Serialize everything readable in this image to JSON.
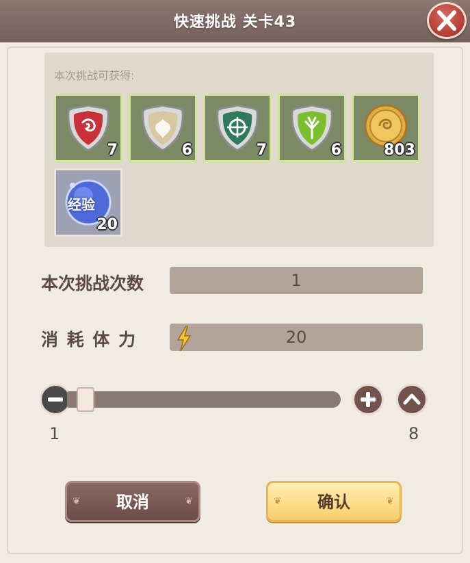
{
  "header": {
    "title": "快速挑战 关卡43"
  },
  "rewards": {
    "label": "本次挑战可获得:",
    "items": [
      {
        "icon": "red-shield-emblem-icon",
        "count": "7",
        "color": "#c8303a"
      },
      {
        "icon": "beige-shield-emblem-icon",
        "count": "6",
        "color": "#d8c7a0"
      },
      {
        "icon": "teal-shield-emblem-icon",
        "count": "7",
        "color": "#2f7a5c"
      },
      {
        "icon": "green-shield-emblem-icon",
        "count": "6",
        "color": "#7cbf2e"
      },
      {
        "icon": "gold-coin-icon",
        "count": "803",
        "color": "#d9a640"
      },
      {
        "icon": "experience-orb-icon",
        "count": "20",
        "label": "经验",
        "color": "#4d6ad8"
      }
    ]
  },
  "attempts": {
    "label": "本次挑战次数",
    "value": "1"
  },
  "stamina": {
    "label": "消 耗 体 力",
    "value": "20",
    "icon": "lightning-icon"
  },
  "slider": {
    "min": "1",
    "max": "8",
    "current": 1
  },
  "buttons": {
    "cancel": "取消",
    "confirm": "确认"
  },
  "colors": {
    "accent": "#f6cf6a",
    "panel": "#f0ebe3",
    "header": "#7e6862"
  }
}
